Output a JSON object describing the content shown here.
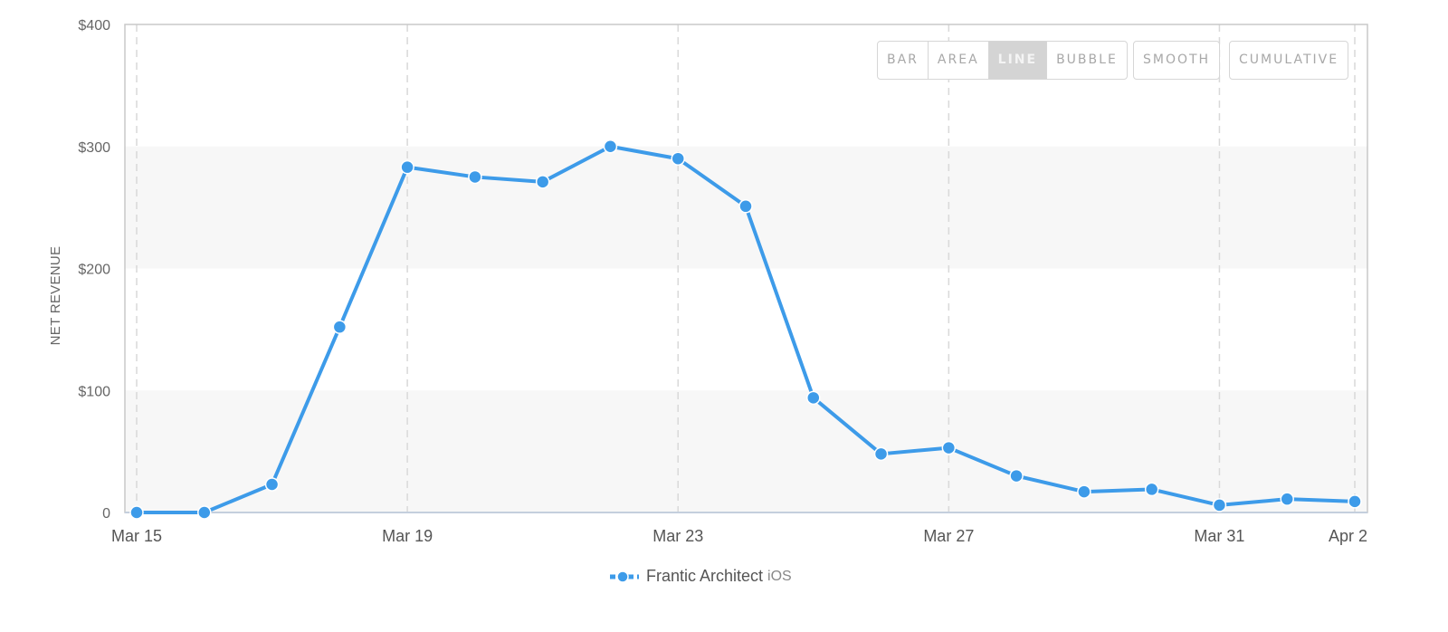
{
  "controls": {
    "chart_types": [
      {
        "label": "BAR",
        "active": false
      },
      {
        "label": "AREA",
        "active": false
      },
      {
        "label": "LINE",
        "active": true
      },
      {
        "label": "BUBBLE",
        "active": false
      }
    ],
    "smooth_label": "SMOOTH",
    "cumulative_label": "CUMULATIVE"
  },
  "legend": {
    "series_name": "Frantic Architect",
    "platform": "iOS",
    "icon": "line-marker-icon"
  },
  "colors": {
    "series": "#3d9be9",
    "grid_band": "#f7f7f7",
    "grid_dash": "#d9d9d9",
    "axis": "#c8c8c8"
  },
  "chart_data": {
    "type": "line",
    "title": "",
    "xlabel": "",
    "ylabel": "NET REVENUE",
    "ylim": [
      0,
      400
    ],
    "yticks": [
      0,
      100,
      200,
      300,
      400
    ],
    "ytick_labels": [
      "0",
      "$100",
      "$200",
      "$300",
      "$400"
    ],
    "x": [
      "Mar 15",
      "Mar 16",
      "Mar 17",
      "Mar 18",
      "Mar 19",
      "Mar 20",
      "Mar 21",
      "Mar 22",
      "Mar 23",
      "Mar 24",
      "Mar 25",
      "Mar 26",
      "Mar 27",
      "Mar 28",
      "Mar 29",
      "Mar 30",
      "Mar 31",
      "Apr 1",
      "Apr 2"
    ],
    "xtick_labels": [
      "Mar 15",
      "Mar 19",
      "Mar 23",
      "Mar 27",
      "Mar 31",
      "Apr 2"
    ],
    "grid": true,
    "legend_position": "bottom",
    "series": [
      {
        "name": "Frantic Architect iOS",
        "values": [
          0,
          0,
          23,
          152,
          283,
          275,
          271,
          300,
          290,
          251,
          94,
          48,
          53,
          30,
          17,
          19,
          6,
          11,
          9
        ]
      }
    ]
  }
}
